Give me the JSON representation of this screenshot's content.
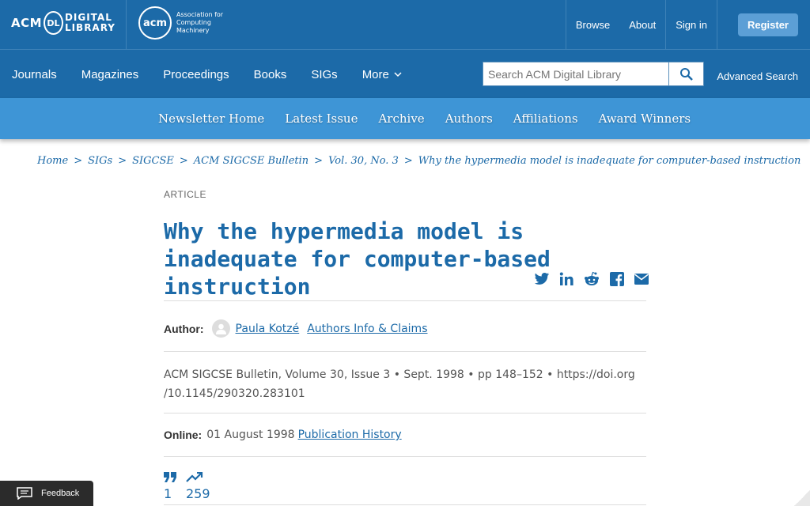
{
  "topbar": {
    "logo_dl": {
      "acm": "ACM",
      "dl": "DL",
      "line1": "DIGITAL",
      "line2": "LIBRARY"
    },
    "logo_acm": {
      "mark": "acm",
      "text": "Association for Computing Machinery"
    },
    "links": [
      "Browse",
      "About",
      "Sign in"
    ],
    "register": "Register"
  },
  "navbar": {
    "items": [
      "Journals",
      "Magazines",
      "Proceedings",
      "Books",
      "SIGs",
      "More"
    ],
    "search_placeholder": "Search ACM Digital Library",
    "advanced": "Advanced Search"
  },
  "sigbar": {
    "items": [
      "Newsletter Home",
      "Latest Issue",
      "Archive",
      "Authors",
      "Affiliations",
      "Award Winners"
    ]
  },
  "breadcrumb": [
    "Home",
    "SIGs",
    "SIGCSE",
    "ACM SIGCSE Bulletin",
    "Vol. 30, No. 3",
    "Why the hypermedia model is inadequate for computer-based instruction"
  ],
  "article": {
    "type": "ARTICLE",
    "title": "Why the hypermedia model is inadequate for computer-based instruction",
    "author_label": "Author:",
    "author_name": "Paula Kotzé",
    "authors_info": "Authors Info & Claims",
    "pub_line1": "ACM SIGCSE Bulletin, Volume 30, Issue 3 • Sept. 1998  • pp 148–152 • https://doi.org",
    "pub_line2": "/10.1145/290320.283101",
    "online_label": "Online:",
    "online_date": "01 August 1998",
    "pub_history": "Publication History",
    "citations": "1",
    "downloads": "259"
  },
  "share_icons": [
    "twitter-icon",
    "linkedin-icon",
    "reddit-icon",
    "facebook-icon",
    "email-icon"
  ],
  "feedback": "Feedback",
  "colors": {
    "primary": "#1c6aa8",
    "secondary": "#3e95d6"
  }
}
